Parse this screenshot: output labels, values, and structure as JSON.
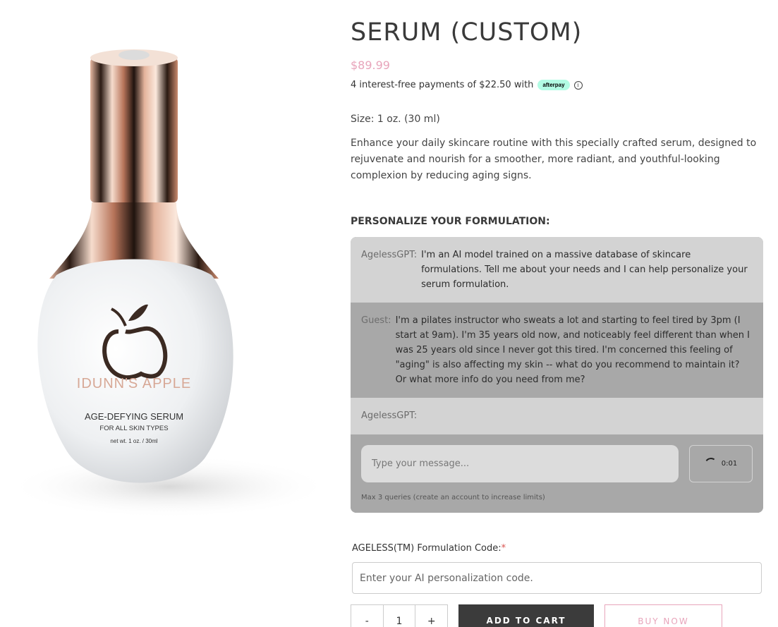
{
  "product": {
    "title": "SERUM (CUSTOM)",
    "price": "$89.99",
    "installments_text": "4 interest-free payments of $22.50 with",
    "afterpay_label": "afterpay",
    "size": "Size: 1 oz. (30 ml)",
    "description": "Enhance your daily skincare routine with this specially crafted serum, designed to rejuvenate and nourish for a smoother, more radiant, and youthful-looking complexion by reducing aging signs."
  },
  "bottle": {
    "brand": "IDUNN'S APPLE",
    "line1": "AGE-DEFYING SERUM",
    "line2": "FOR ALL SKIN TYPES",
    "line3": "net wt. 1 oz. / 30ml"
  },
  "personalize_heading": "PERSONALIZE YOUR FORMULATION:",
  "chat": {
    "messages": [
      {
        "sender": "AgelessGPT:",
        "text": "I'm an AI model trained on a massive database of skincare formulations. Tell me about your needs and I can help personalize your serum formulation."
      },
      {
        "sender": "Guest:",
        "text": "I'm a pilates instructor who sweats a lot and starting to feel tired by 3pm (I start at 9am). I'm 35 years old now, and noticeably feel different than when I was 25 years old since I never got this tired. I'm concerned this feeling of \"aging\" is also affecting my skin -- what do you recommend to maintain it? Or what more info do you need from me?"
      },
      {
        "sender": "AgelessGPT:",
        "text": ""
      }
    ],
    "input_placeholder": "Type your message...",
    "timer": "0:01",
    "limit_note": "Max 3 queries (create an account to increase limits)"
  },
  "code_field": {
    "label": "AGELESS(TM) Formulation Code:",
    "required_mark": "*",
    "placeholder": "Enter your AI personalization code."
  },
  "cart": {
    "minus": "-",
    "quantity": "1",
    "plus": "+",
    "add_to_cart": "ADD TO CART",
    "buy_now": "BUY NOW"
  },
  "colors": {
    "accent_pink": "#e8a5bb",
    "afterpay_mint": "#b2fce4",
    "dark_button": "#3b3b3b",
    "rose_gold": "#c98a6e"
  }
}
